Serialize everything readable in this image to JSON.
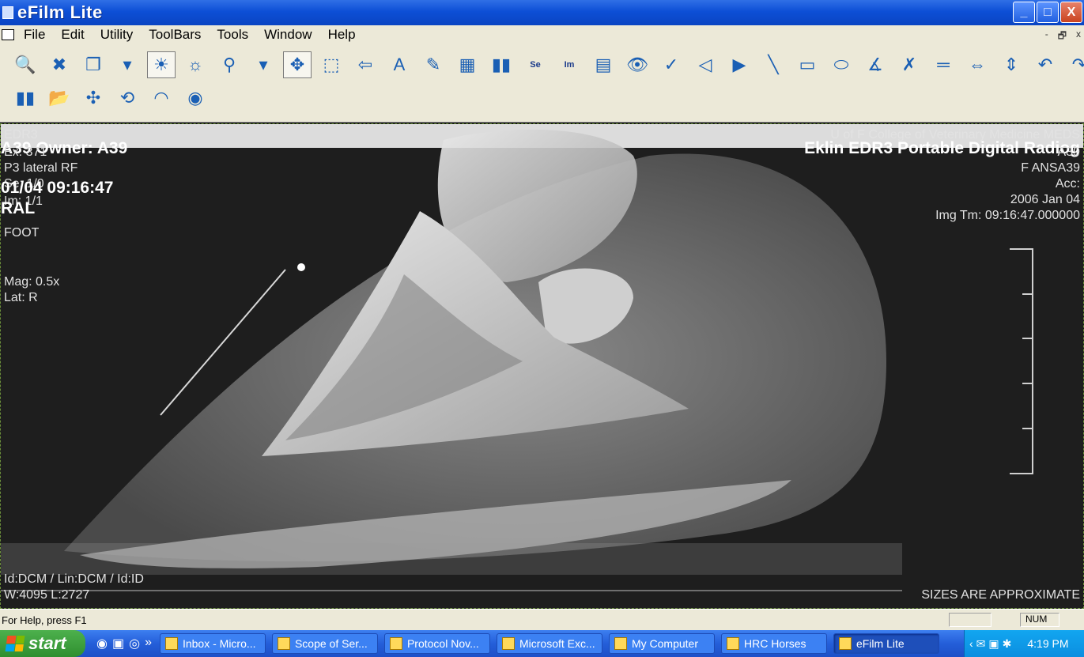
{
  "window": {
    "title": "eFilm Lite",
    "controls": {
      "minimize": "_",
      "maximize": "□",
      "close": "X"
    }
  },
  "menu": {
    "items": [
      "File",
      "Edit",
      "Utility",
      "ToolBars",
      "Tools",
      "Window",
      "Help"
    ],
    "mdi_controls": [
      "-",
      "🗗",
      "x"
    ]
  },
  "toolbar": {
    "row1": [
      {
        "name": "zoom-page-icon",
        "glyph": "🔍"
      },
      {
        "name": "delete-icon",
        "glyph": "✖"
      },
      {
        "name": "stack-icon",
        "glyph": "❐"
      },
      {
        "name": "dropdown-icon",
        "glyph": "▾"
      },
      {
        "name": "window-level-icon",
        "glyph": "☀",
        "pressed": true
      },
      {
        "name": "brightness-icon",
        "glyph": "☼"
      },
      {
        "name": "magnifier-icon",
        "glyph": "⚲"
      },
      {
        "name": "dropdown-icon-2",
        "glyph": "▾"
      },
      {
        "name": "pan-icon",
        "glyph": "✥",
        "pressed": true
      },
      {
        "name": "zoom-box-icon",
        "glyph": "⬚"
      },
      {
        "name": "back-arrow-icon",
        "glyph": "⇦"
      },
      {
        "name": "annotation-text-icon",
        "glyph": "A"
      },
      {
        "name": "edit-annotation-icon",
        "glyph": "✎"
      },
      {
        "name": "layout-grid-icon",
        "glyph": "▦"
      },
      {
        "name": "series-compare-icon",
        "glyph": "▮▮"
      },
      {
        "name": "series-icon",
        "glyph": "Se",
        "txt": true
      },
      {
        "name": "image-icon",
        "glyph": "Im",
        "txt": true
      },
      {
        "name": "report-icon",
        "glyph": "▤"
      },
      {
        "name": "view-icon",
        "glyph": "👁"
      },
      {
        "name": "scan-icon",
        "glyph": "✓"
      },
      {
        "name": "play-reverse-icon",
        "glyph": "◁"
      },
      {
        "name": "play-icon",
        "glyph": "▶"
      },
      {
        "name": "line-measure-icon",
        "glyph": "╲"
      },
      {
        "name": "ruler-icon",
        "glyph": "▭"
      },
      {
        "name": "ellipse-roi-icon",
        "glyph": "⬭"
      },
      {
        "name": "angle-icon",
        "glyph": "∡"
      },
      {
        "name": "delete-measure-icon",
        "glyph": "✗"
      },
      {
        "name": "calibrate-icon",
        "glyph": "═"
      },
      {
        "name": "flip-horizontal-icon",
        "glyph": "⇔"
      },
      {
        "name": "flip-vertical-icon",
        "glyph": "⇕"
      },
      {
        "name": "undo-icon",
        "glyph": "↶"
      },
      {
        "name": "redo-icon",
        "glyph": "↷"
      }
    ],
    "row2": [
      {
        "name": "cine-icon",
        "glyph": "▮▮"
      },
      {
        "name": "open-folder-icon",
        "glyph": "📂"
      },
      {
        "name": "move-icon",
        "glyph": "✣"
      },
      {
        "name": "rotate-icon",
        "glyph": "⟲"
      },
      {
        "name": "eye-close-icon",
        "glyph": "◠"
      },
      {
        "name": "eye-open-icon",
        "glyph": "◉"
      }
    ]
  },
  "overlay": {
    "top_left": [
      "EDR3",
      "A39 Owner: A39",
      "Ex: 371",
      "P3 lateral RF",
      "Se: 1/0",
      "01/04 09:16:47",
      "Im: 1/1",
      "RAL",
      "FOOT",
      "Mag: 0.5x",
      "Lat: R"
    ],
    "top_right": [
      "U of F College of Veterinary Medicine MEDS",
      "Eklin EDR3 Portable Digital Radiog",
      "A39",
      "F  ANSA39",
      "Acc:",
      "2006 Jan 04",
      "Img Tm: 09:16:47.000000"
    ],
    "bottom_left": [
      "Id:DCM / Lin:DCM / Id:ID",
      "W:4095  L:2727"
    ],
    "bottom_right": "SIZES ARE APPROXIMATE"
  },
  "status": {
    "help": "For Help, press F1",
    "num": "NUM"
  },
  "taskbar": {
    "start": "start",
    "tasks": [
      {
        "label": "Inbox - Micro...",
        "active": false
      },
      {
        "label": "Scope of Ser...",
        "active": false
      },
      {
        "label": "Protocol Nov...",
        "active": false
      },
      {
        "label": "Microsoft Exc...",
        "active": false
      },
      {
        "label": "My Computer",
        "active": false
      },
      {
        "label": "HRC Horses",
        "active": false
      },
      {
        "label": "eFilm Lite",
        "active": true
      }
    ],
    "clock": "4:19 PM"
  }
}
